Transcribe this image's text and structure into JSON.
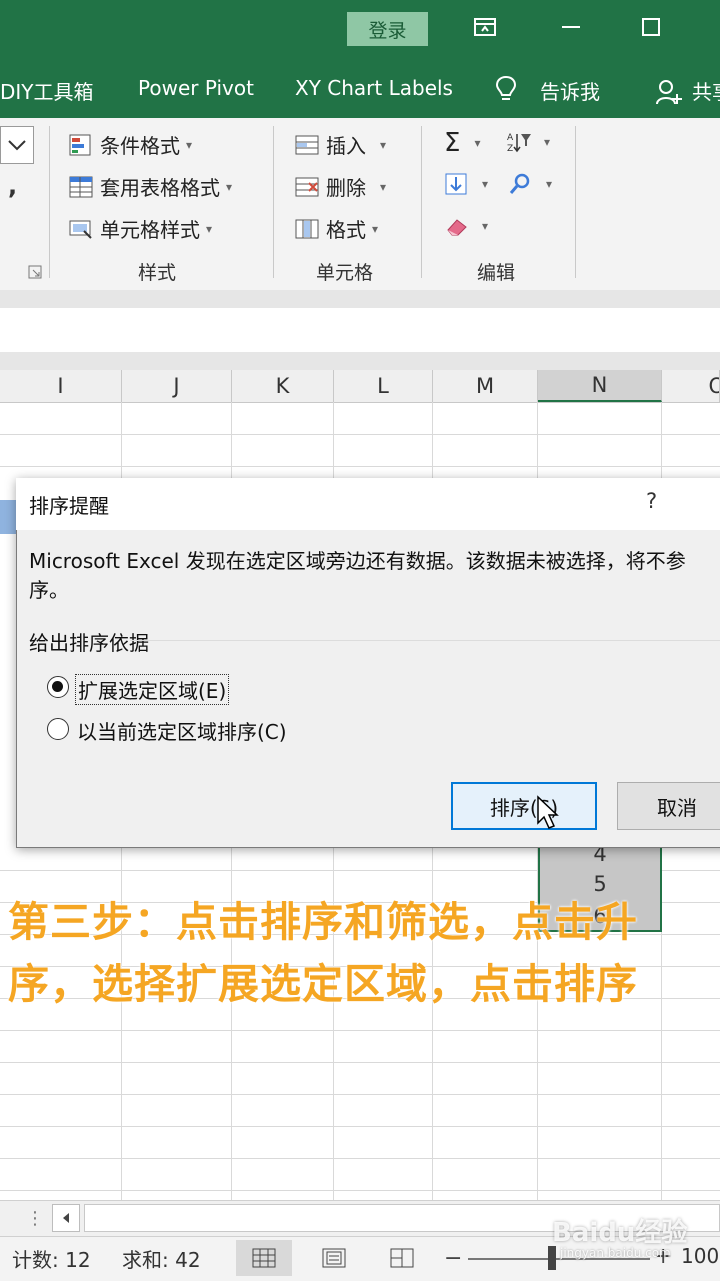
{
  "titlebar": {
    "login": "登录"
  },
  "tabs": [
    {
      "label": "DIY工具箱"
    },
    {
      "label": "Power Pivot"
    },
    {
      "label": "XY Chart Labels"
    },
    {
      "label": "告诉我"
    },
    {
      "label": "共享"
    }
  ],
  "ribbon": {
    "styles": {
      "items": [
        "条件格式",
        "套用表格格式",
        "单元格样式"
      ],
      "label": "样式"
    },
    "cells": {
      "items": [
        "插入",
        "删除",
        "格式"
      ],
      "label": "单元格"
    },
    "editing": {
      "label": "编辑"
    }
  },
  "columns": [
    "I",
    "J",
    "K",
    "L",
    "M",
    "N",
    "O"
  ],
  "selection_values": [
    "4",
    "5",
    "6"
  ],
  "dialog": {
    "title": "排序提醒",
    "help": "?",
    "message_line1": "Microsoft Excel 发现在选定区域旁边还有数据。该数据未被选择，将不参",
    "message_line2": "序。",
    "group_label": "给出排序依据",
    "options": [
      {
        "label": "扩展选定区域(E)",
        "selected": true
      },
      {
        "label": "以当前选定区域排序(C)",
        "selected": false
      }
    ],
    "sort_button": "排序(S)",
    "cancel_button": "取消"
  },
  "caption": {
    "line1": "第三步：点击排序和筛选，点击升",
    "line2": "序，选择扩展选定区域，点击排序"
  },
  "statusbar": {
    "count": "计数: 12",
    "sum": "求和: 42",
    "zoom": "100"
  },
  "watermark": {
    "brand": "Baidu经验",
    "url": "jingyan.baidu.com"
  },
  "colors": {
    "excel_green": "#217346",
    "caption_orange": "#f5a623",
    "focus_blue": "#0078d7"
  }
}
